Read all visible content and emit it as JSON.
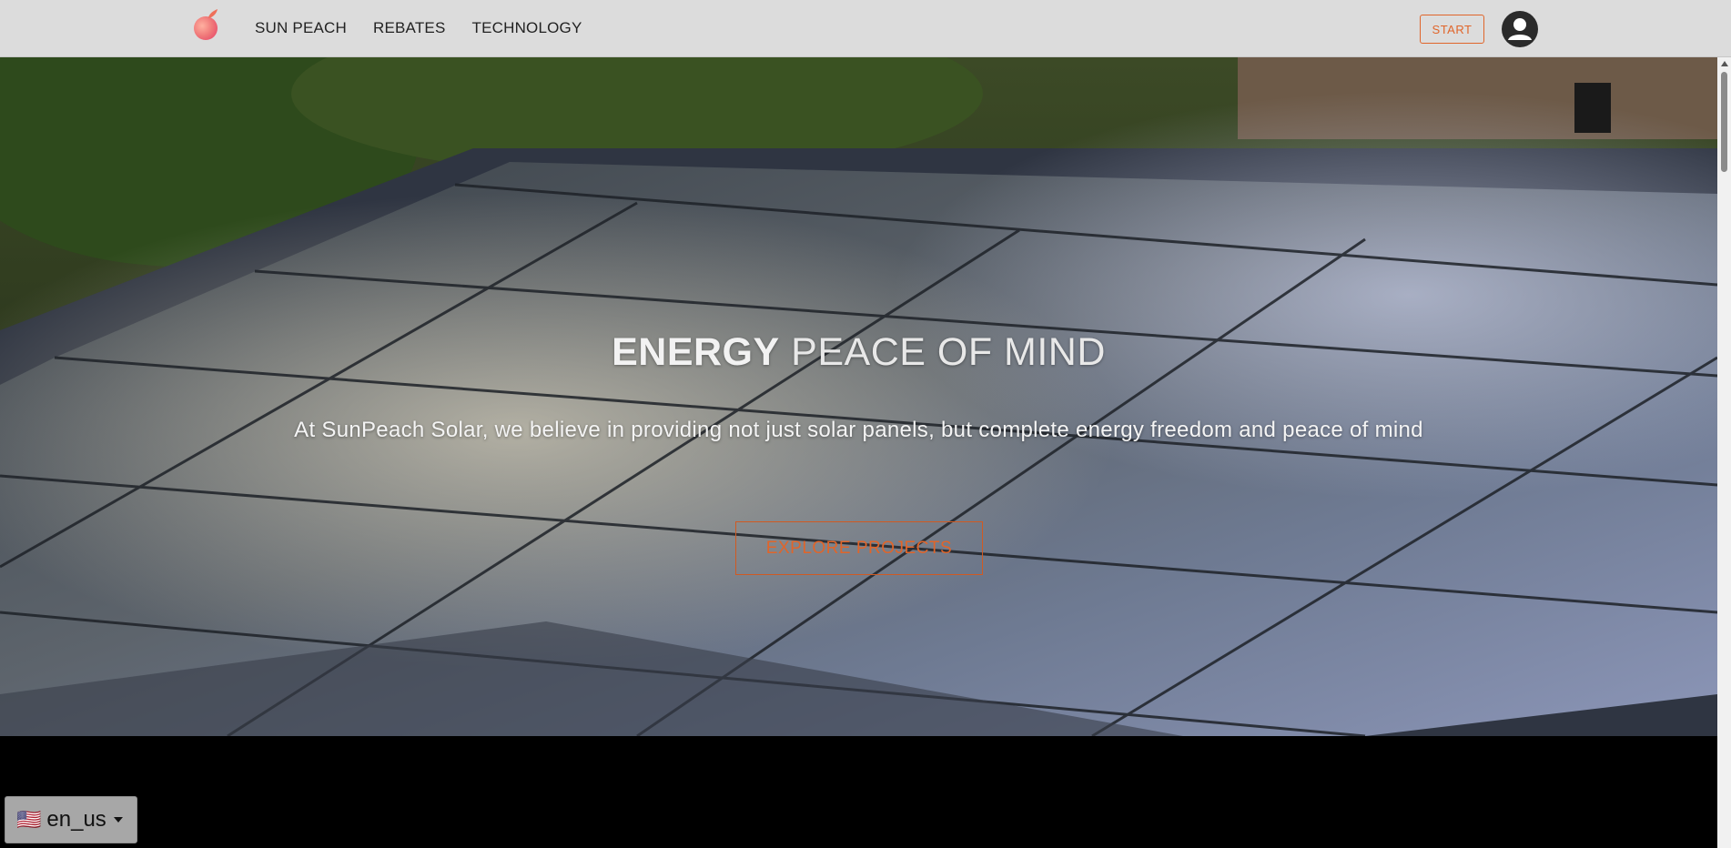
{
  "nav": {
    "links": [
      "SUN PEACH",
      "REBATES",
      "TECHNOLOGY"
    ],
    "start_label": "START"
  },
  "hero": {
    "title_bold": "ENERGY",
    "title_rest": " PEACE OF MIND",
    "subtitle": "At SunPeach Solar, we believe in providing not just solar panels, but complete energy freedom and peace of mind",
    "cta_label": "EXPLORE PROJECTS"
  },
  "language": {
    "flag": "🇺🇸",
    "value": "en_us"
  },
  "icons": {
    "logo": "peach-logo-icon",
    "avatar": "user-account-icon",
    "caret": "caret-down-icon"
  },
  "colors": {
    "accent": "#e0652a",
    "navbar_bg": "#dcdcdc",
    "footer_bg": "#000000"
  }
}
